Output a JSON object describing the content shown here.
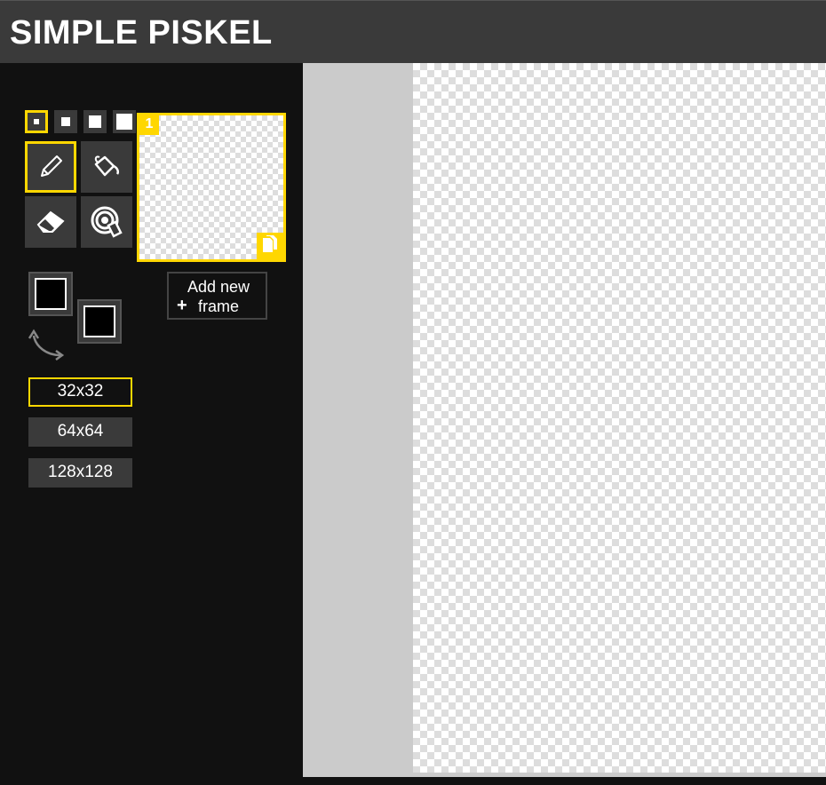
{
  "app": {
    "title": "SIMPLE PISKEL"
  },
  "pen_sizes": [
    {
      "size": 1,
      "selected": true
    },
    {
      "size": 2,
      "selected": false
    },
    {
      "size": 3,
      "selected": false
    },
    {
      "size": 4,
      "selected": false
    }
  ],
  "tools": [
    {
      "name": "pencil-icon",
      "selected": true
    },
    {
      "name": "paint-bucket-icon",
      "selected": false
    },
    {
      "name": "eraser-icon",
      "selected": false
    },
    {
      "name": "color-picker-icon",
      "selected": false
    }
  ],
  "frames": [
    {
      "number": "1",
      "selected": true
    }
  ],
  "add_frame": {
    "line1": "Add new",
    "plus": "+",
    "line2": "frame"
  },
  "colors": {
    "primary": "#000000",
    "secondary": "#000000",
    "accent": "#ffd700"
  },
  "resolutions": [
    {
      "label": "32x32",
      "selected": true
    },
    {
      "label": "64x64",
      "selected": false
    },
    {
      "label": "128x128",
      "selected": false
    }
  ]
}
